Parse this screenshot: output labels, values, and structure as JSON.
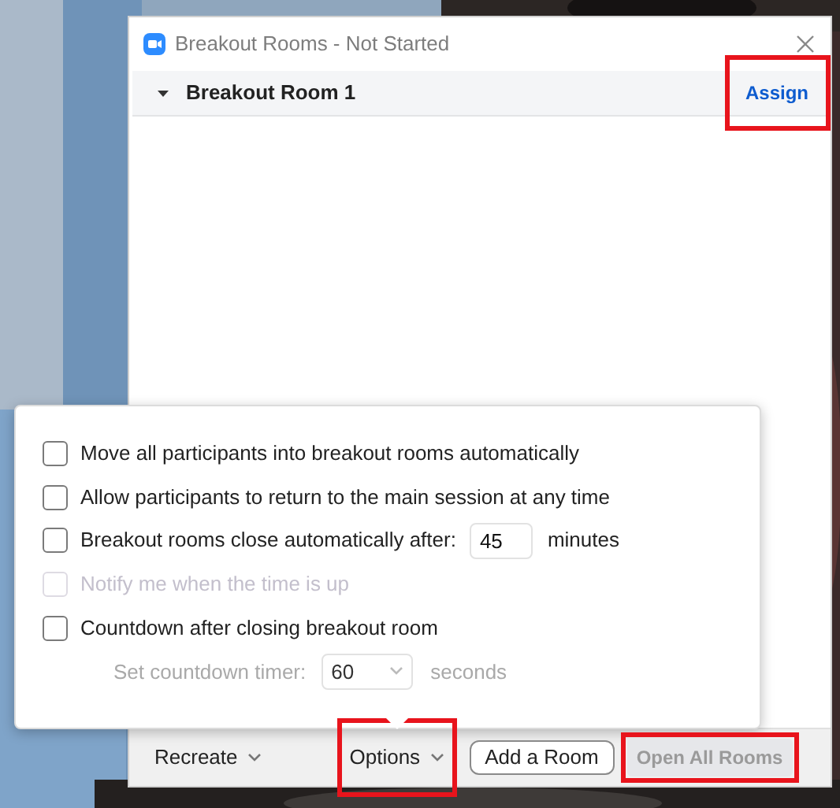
{
  "window": {
    "title": "Breakout Rooms - Not Started"
  },
  "rooms": [
    {
      "name": "Breakout Room 1",
      "expanded": true,
      "action": {
        "label": "Assign",
        "highlighted": true
      }
    }
  ],
  "options_popup": {
    "items": [
      {
        "kind": "checkbox",
        "label": "Move all participants into breakout rooms automatically",
        "checked": false,
        "disabled": false
      },
      {
        "kind": "checkbox",
        "label": "Allow participants to return to the main session at any time",
        "checked": false,
        "disabled": false
      },
      {
        "kind": "checkbox_input",
        "label": "Breakout rooms close automatically after:",
        "value": "45",
        "unit": "minutes",
        "checked": false,
        "disabled": false
      },
      {
        "kind": "checkbox",
        "label": "Notify me when the time is up",
        "checked": false,
        "disabled": true
      },
      {
        "kind": "checkbox",
        "label": "Countdown after closing breakout room",
        "checked": false,
        "disabled": false
      },
      {
        "kind": "select",
        "label": "Set countdown timer:",
        "value": "60",
        "unit": "seconds",
        "disabled": true
      }
    ]
  },
  "footer": {
    "buttons": [
      {
        "kind": "menu",
        "label": "Recreate",
        "highlighted": false,
        "expanded": false
      },
      {
        "kind": "menu",
        "label": "Options",
        "highlighted": true,
        "expanded": true
      },
      {
        "kind": "outlined",
        "label": "Add a Room",
        "highlighted": false
      },
      {
        "kind": "primary",
        "label": "Open All Rooms",
        "highlighted": true,
        "disabled": true
      }
    ]
  }
}
